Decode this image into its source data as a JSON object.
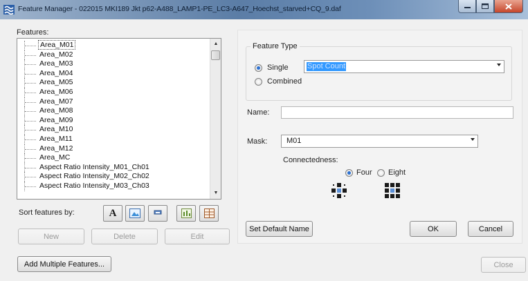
{
  "window": {
    "title": "Feature Manager - 022015 MKI189 Jkt p62-A488_LAMP1-PE_LC3-A647_Hoechst_starved+CQ_9.daf"
  },
  "features": {
    "label": "Features:",
    "items": [
      "Area_M01",
      "Area_M02",
      "Area_M03",
      "Area_M04",
      "Area_M05",
      "Area_M06",
      "Area_M07",
      "Area_M08",
      "Area_M09",
      "Area_M10",
      "Area_M11",
      "Area_M12",
      "Area_MC",
      "Aspect Ratio Intensity_M01_Ch01",
      "Aspect Ratio Intensity_M02_Ch02",
      "Aspect Ratio Intensity_M03_Ch03"
    ],
    "selected_index": 0
  },
  "sort": {
    "label": "Sort features by:",
    "buttons": [
      "alpha-sort-icon",
      "image-sort-icon",
      "tag-sort-icon",
      "stats-sort-icon",
      "table-sort-icon"
    ],
    "alpha_glyph": "A"
  },
  "list_buttons": {
    "new": "New",
    "delete": "Delete",
    "edit": "Edit"
  },
  "add_multiple": "Add Multiple Features...",
  "feature_type": {
    "title": "Feature Type",
    "single_label": "Single",
    "combined_label": "Combined",
    "selected": "Single",
    "type_value": "Spot Count"
  },
  "name": {
    "label": "Name:",
    "value": ""
  },
  "mask": {
    "label": "Mask:",
    "value": "M01"
  },
  "connectedness": {
    "label": "Connectedness:",
    "four_label": "Four",
    "eight_label": "Eight",
    "selected": "Four"
  },
  "actions": {
    "set_default_name": "Set Default Name",
    "ok": "OK",
    "cancel": "Cancel",
    "close": "Close"
  },
  "colors": {
    "selection": "#3399ff",
    "radio_dot": "#2a6fd0",
    "connect_dark": "#1a1a1a",
    "connect_center": "#5b8fd6"
  }
}
